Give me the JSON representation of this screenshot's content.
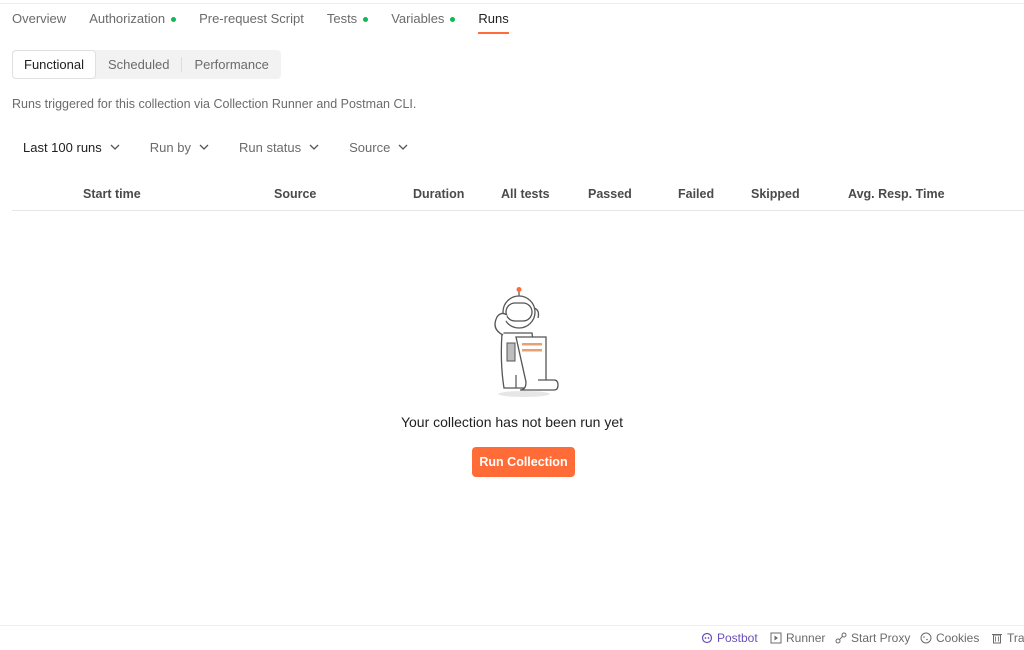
{
  "tabs": [
    {
      "label": "Overview",
      "dot": false,
      "active": false
    },
    {
      "label": "Authorization",
      "dot": true,
      "active": false
    },
    {
      "label": "Pre-request Script",
      "dot": false,
      "active": false
    },
    {
      "label": "Tests",
      "dot": true,
      "active": false
    },
    {
      "label": "Variables",
      "dot": true,
      "active": false
    },
    {
      "label": "Runs",
      "dot": false,
      "active": true
    }
  ],
  "segments": [
    "Functional",
    "Scheduled",
    "Performance"
  ],
  "active_segment": "Functional",
  "description": "Runs triggered for this collection via Collection Runner and Postman CLI.",
  "filters": [
    "Last 100 runs",
    "Run by",
    "Run status",
    "Source"
  ],
  "table": {
    "columns": [
      "Start time",
      "Source",
      "Duration",
      "All tests",
      "Passed",
      "Failed",
      "Skipped",
      "Avg. Resp. Time"
    ]
  },
  "empty_state": {
    "title": "Your collection has not been run yet",
    "button": "Run Collection"
  },
  "statusbar": {
    "postbot": "Postbot",
    "runner": "Runner",
    "proxy": "Start Proxy",
    "cookies": "Cookies",
    "trash": "Tra"
  },
  "colors": {
    "accent": "#ff6c37",
    "dot_green": "#0cbb52",
    "postbot_purple": "#6b4fbb"
  }
}
